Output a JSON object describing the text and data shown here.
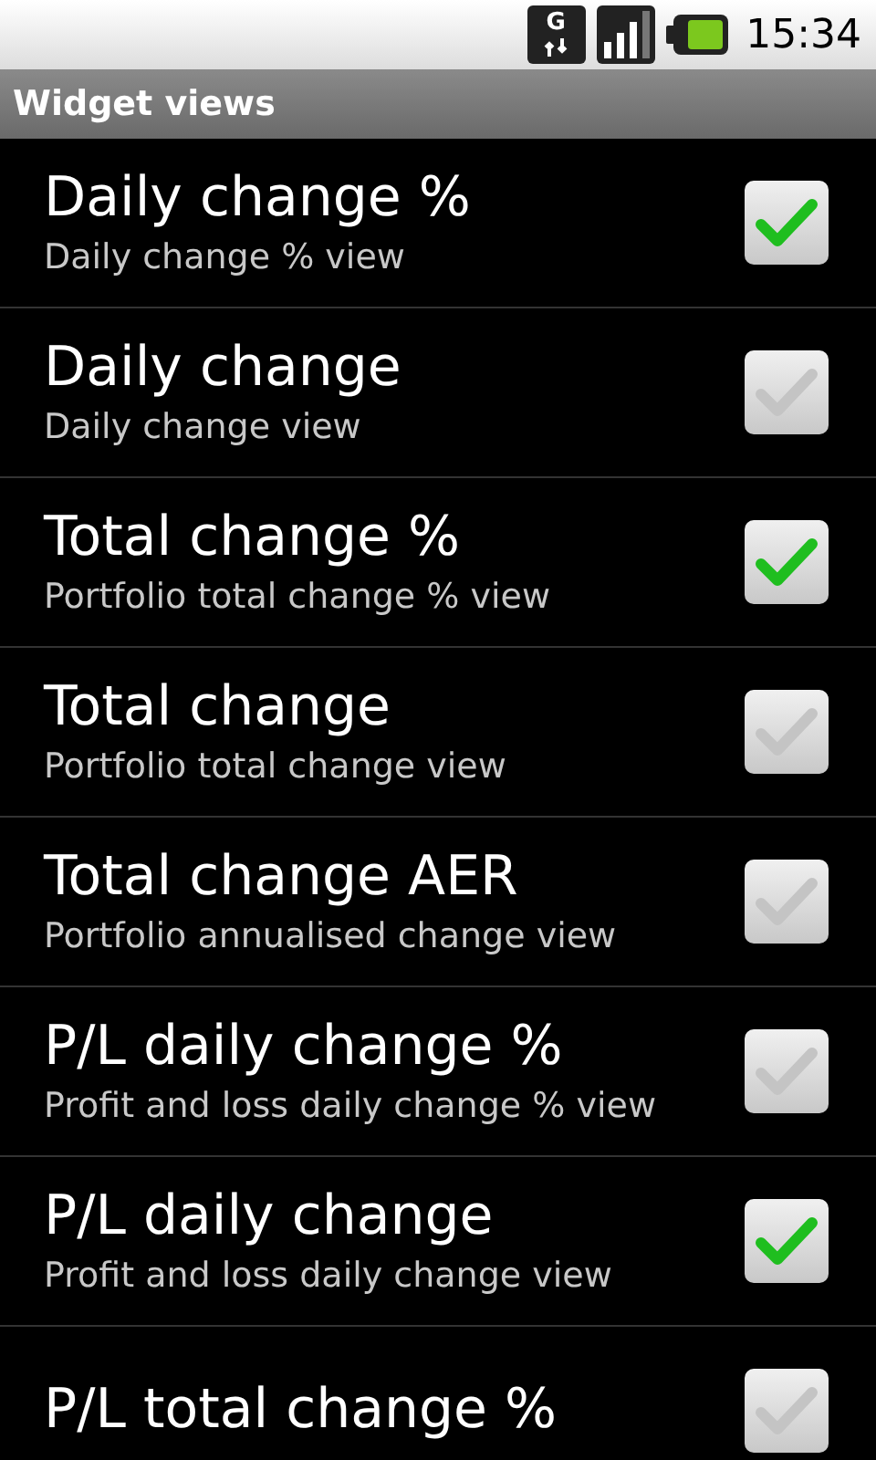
{
  "status_bar": {
    "time": "15:34",
    "network": "G"
  },
  "title_bar": {
    "title": "Widget views"
  },
  "items": [
    {
      "title": "Daily change %",
      "summary": "Daily change % view",
      "checked": true
    },
    {
      "title": "Daily change",
      "summary": "Daily change view",
      "checked": false
    },
    {
      "title": "Total change %",
      "summary": "Portfolio total change % view",
      "checked": true
    },
    {
      "title": "Total change",
      "summary": "Portfolio total change view",
      "checked": false
    },
    {
      "title": "Total change AER",
      "summary": "Portfolio annualised change view",
      "checked": false
    },
    {
      "title": "P/L daily change %",
      "summary": "Profit and loss daily change % view",
      "checked": false
    },
    {
      "title": "P/L daily change",
      "summary": "Profit and loss daily change view",
      "checked": true
    },
    {
      "title": "P/L total change %",
      "checked": false
    }
  ]
}
